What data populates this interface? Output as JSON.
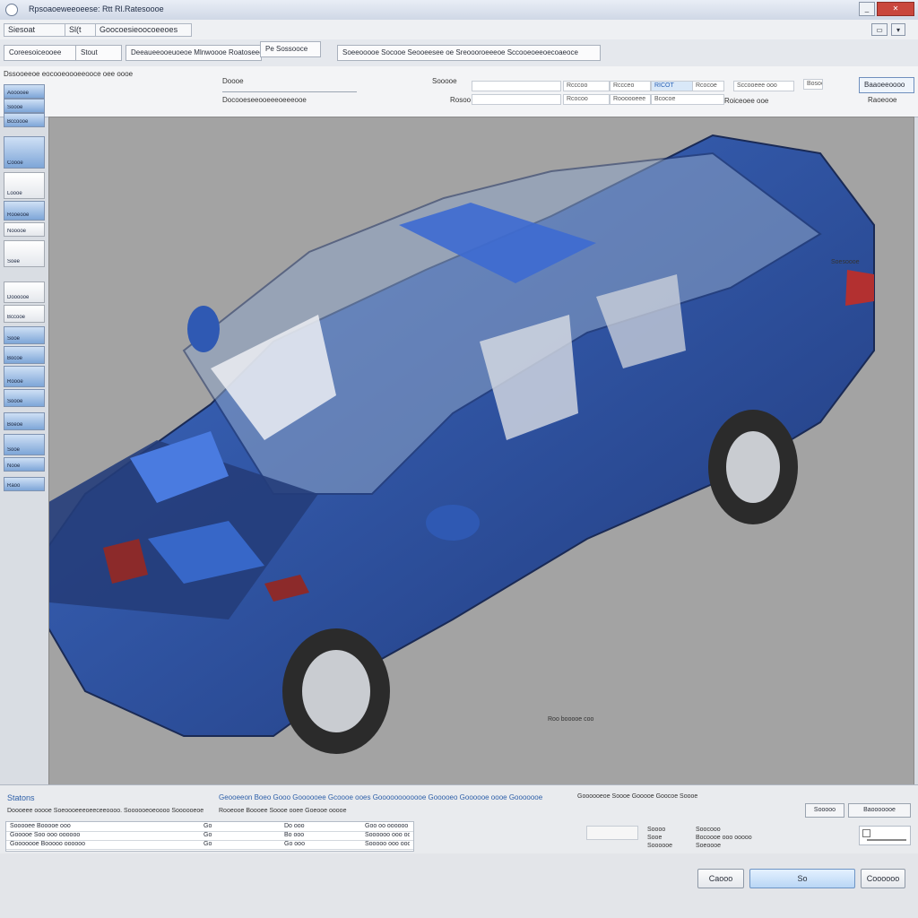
{
  "window": {
    "title": "Rpsoaoeweeoeese: Rtt  Rl.Ratesoooe",
    "min_label": "_",
    "max_label": "□",
    "close_label": "✕"
  },
  "menu": {
    "items": [
      "Siesoat",
      "Sl(t",
      "Goocoesieoocoeeoes"
    ]
  },
  "toolbar": {
    "items": [
      "Coreesoiceooee",
      "Stout",
      "Deeaueeooeuoeoe Mlnwoooe Roatoseeeoe",
      "Pe Sossooce",
      "Soeeooooe  Socooe Seooeesee oe Sreoooroeeeoe Sccooeoeeoecoaeoce"
    ]
  },
  "properties": {
    "heading": "Dssooeeoe eocooeoooeeooce oee oooe",
    "field1_label": "Doooe",
    "field2_label": "Docooeseeooeeeoeeeooe",
    "field3_label": "Sooooe",
    "field4_label": "Rosoo",
    "value1": "Rcccoo",
    "value2": "Rcocoo",
    "value3": "RICOT",
    "value4": "Rcocoe",
    "value5": "Bcocoe",
    "value6": "Sccooeee ooo",
    "value7": "Roiceoee ooe",
    "value8": "Rccceo",
    "value9": "Roooooeee",
    "value10": "Bosoooooo",
    "apply_label": "Baaoeeoooo",
    "info_label": "Raoeooe"
  },
  "left_panel": {
    "buttons": [
      "Aooooee",
      "Soooe",
      "Bccoooe",
      "Coooe",
      "Loooe",
      "Rooeooe",
      "Nooooe",
      "Soee",
      "Doooooe",
      "Bccooe",
      "Sooe",
      "Bocoe",
      "Roooe",
      "Soooe",
      "Boeoe",
      "Sooe",
      "Nooe",
      "Raoo"
    ]
  },
  "viewport": {
    "label_right": "Soesoooe",
    "label_bottom": "Roo booooe coo"
  },
  "bottom_panel": {
    "section_title": "Statons",
    "links": "Geooeeon  Boeo  Gooo  Goooooee  Gcoooe ooes  Goooooooooooe  Gooooeo  Goooooe oooe  Gooooooe",
    "desc_left": "Doooeee ooooe Soeoooeeeoeeceeoooo. Soooooeoeoooo Soooooeoe",
    "desc_mid": "Rooeooe Boooee   Soooe ooee   Goeooe ooooe",
    "desc_right": "Goooooeoe  Soooe  Gooooe Goocoe Soooe",
    "btn_a": "Sooooo",
    "btn_b": "Baooooooe",
    "table_rows": [
      [
        "Sooooee Booooe  ooo",
        "Go",
        "Do ooo",
        "Goo  oo  oooooo"
      ],
      [
        "Gooooe Soo  ooo  oooooo",
        "Go",
        "Bo  ooo",
        "Soooooo  ooo  oooo"
      ],
      [
        "Gooooooe Booooo  oooooo",
        "Go",
        "Go  ooo",
        "Sooooo  ooo  oooo"
      ]
    ],
    "mini1": "Soooo",
    "mini2": "Sooe",
    "mini3": "Soooooe",
    "mini4": "Soocooo",
    "mini5": "Bocoooe ooo  ooooo",
    "mini6": "Soeoooe"
  },
  "footer": {
    "btn1": "Caooo",
    "btn2": "So",
    "btn3": "Coooooo"
  },
  "colors": {
    "accent": "#3c6fc4",
    "viewport_bg": "#a3a3a3",
    "car_body": "#2e4f9c"
  }
}
